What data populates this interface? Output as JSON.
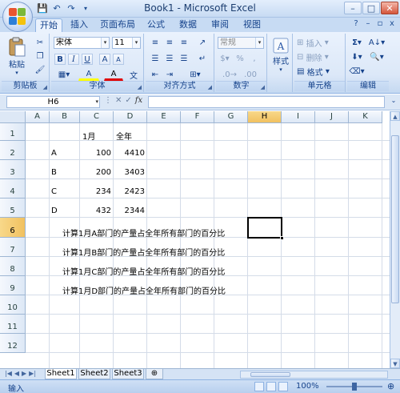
{
  "window": {
    "title": "Book1 - Microsoft Excel",
    "minimize": "–",
    "maximize": "□",
    "close": "✕"
  },
  "ribbon_tabs": [
    "开始",
    "插入",
    "页面布局",
    "公式",
    "数据",
    "审阅",
    "视图"
  ],
  "home": {
    "clipboard": {
      "paste": "粘贴",
      "label": "剪贴板"
    },
    "font": {
      "name": "宋体",
      "size": "11",
      "bold": "B",
      "italic": "I",
      "underline": "U",
      "grow": "A",
      "shrink": "A",
      "fill": "A",
      "color": "A",
      "label": "字体"
    },
    "alignment": {
      "label": "对齐方式"
    },
    "number": {
      "format": "常规",
      "percent": "%",
      "comma": ",",
      "label": "数字"
    },
    "styles": {
      "label": "样式"
    },
    "cells": {
      "insert": "插入",
      "delete": "删除",
      "format": "格式",
      "label": "单元格"
    },
    "editing": {
      "sum": "Σ",
      "label": "编辑"
    }
  },
  "formula_bar": {
    "name_box": "H6",
    "fx": "fx",
    "formula": ""
  },
  "columns": [
    "A",
    "B",
    "C",
    "D",
    "E",
    "F",
    "G",
    "H",
    "I",
    "J",
    "K"
  ],
  "rows": [
    "1",
    "2",
    "3",
    "4",
    "5",
    "6",
    "7",
    "8",
    "9",
    "10",
    "11",
    "12"
  ],
  "cells": {
    "C1": "1月",
    "D1": "全年",
    "B2": "A",
    "C2": "100",
    "D2": "4410",
    "B3": "B",
    "C3": "200",
    "D3": "3403",
    "B4": "C",
    "C4": "234",
    "D4": "2423",
    "B5": "D",
    "C5": "432",
    "D5": "2344",
    "B6": "计算1月A部门的产量占全年所有部门的百分比",
    "B7": "计算1月B部门的产量占全年所有部门的百分比",
    "B8": "计算1月C部门的产量占全年所有部门的百分比",
    "B9": "计算1月D部门的产量占全年所有部门的百分比"
  },
  "sheet_tabs": [
    "Sheet1",
    "Sheet2",
    "Sheet3"
  ],
  "status": {
    "mode": "输入",
    "zoom": "100%"
  }
}
